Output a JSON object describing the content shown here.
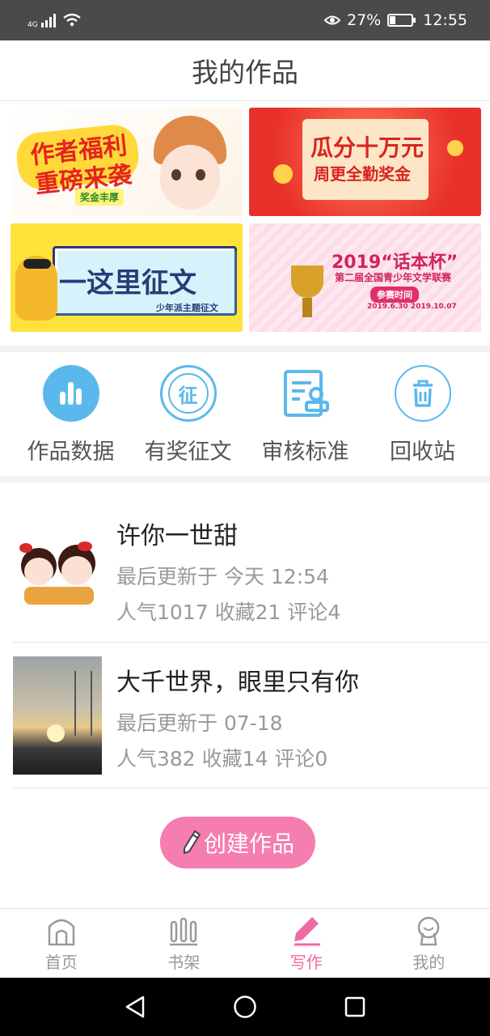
{
  "status": {
    "network": "4G",
    "battery": "27%",
    "battery_level": 0.27,
    "time": "12:55"
  },
  "header": {
    "title": "我的作品"
  },
  "banners": [
    {
      "line1": "作者福利",
      "line2": "重磅来袭",
      "badge": "奖金丰厚"
    },
    {
      "line1": "瓜分十万元",
      "line2": "周更全勤奖金"
    },
    {
      "line1": "一这里征文",
      "sub": "少年派主题征文"
    },
    {
      "line1": "2019“话本杯”",
      "line2": "第二届全国青少年文学联赛",
      "badge": "参赛时间",
      "dates": "2019.6.30   2019.10.07"
    }
  ],
  "quick_actions": [
    {
      "label": "作品数据",
      "icon": "bar-chart-icon"
    },
    {
      "label": "有奖征文",
      "icon": "contest-icon",
      "glyph": "征"
    },
    {
      "label": "审核标准",
      "icon": "document-stamp-icon"
    },
    {
      "label": "回收站",
      "icon": "trash-icon"
    }
  ],
  "works": [
    {
      "title": "许你一世甜",
      "updated": "最后更新于 今天 12:54",
      "stats": "人气1017 收藏21 评论4"
    },
    {
      "title": "大千世界，眼里只有你",
      "updated": "最后更新于 07-18",
      "stats": "人气382 收藏14 评论0"
    }
  ],
  "create_button": {
    "label": "创建作品"
  },
  "tabs": [
    {
      "label": "首页",
      "icon": "home-icon"
    },
    {
      "label": "书架",
      "icon": "bookshelf-icon"
    },
    {
      "label": "写作",
      "icon": "pen-icon",
      "active": true
    },
    {
      "label": "我的",
      "icon": "profile-icon"
    }
  ],
  "colors": {
    "accent": "#f06aa3",
    "icon_blue": "#5bb8ec",
    "button_pink": "#f57db0"
  }
}
